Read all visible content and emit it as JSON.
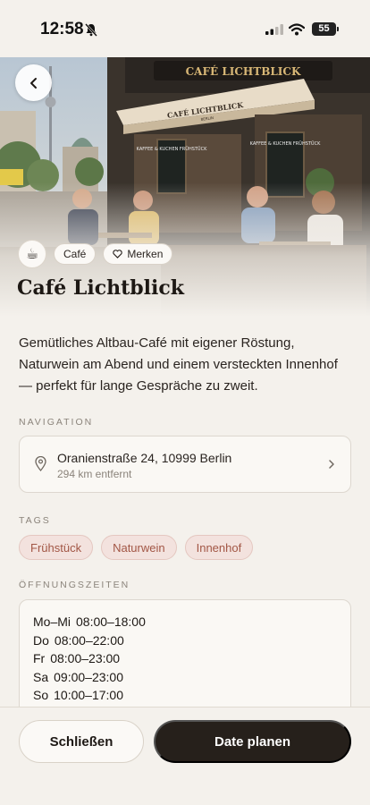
{
  "status": {
    "time": "12:58",
    "battery": "55"
  },
  "hero": {
    "sign_main": "CAFÉ LICHTBLICK",
    "sign_awning": "CAFÉ LICHTBLICK",
    "sign_awning_sub": "BERLIN",
    "board_left": "KAFFEE & KUCHEN FRÜHSTÜCK",
    "board_right": "KAFFEE & KUCHEN FRÜHSTÜCK"
  },
  "chips": {
    "category": "Café",
    "save": "Merken"
  },
  "place": {
    "title": "Café Lichtblick",
    "description": "Gemütliches Altbau-Café mit eigener Röstung, Naturwein am Abend und einem versteckten Innenhof — perfekt für lange Gespräche zu zweit."
  },
  "navigation": {
    "label": "NAVIGATION",
    "address": "Oranienstraße 24, 10999 Berlin",
    "distance": "294 km entfernt"
  },
  "tags": {
    "label": "TAGS",
    "items": [
      "Frühstück",
      "Naturwein",
      "Innenhof"
    ]
  },
  "hours": {
    "label": "ÖFFNUNGSZEITEN",
    "rows": [
      {
        "day": "Mo–Mi",
        "time": "08:00–18:00"
      },
      {
        "day": "Do",
        "time": "08:00–22:00"
      },
      {
        "day": "Fr",
        "time": "08:00–23:00"
      },
      {
        "day": "Sa",
        "time": "09:00–23:00"
      },
      {
        "day": "So",
        "time": "10:00–17:00"
      }
    ]
  },
  "actions": {
    "close": "Schließen",
    "plan": "Date planen"
  },
  "colors": {
    "accent_dark": "#26201b",
    "tag_text": "#a25645",
    "tag_bg": "#f3e2de",
    "background": "#f4f1ec"
  }
}
